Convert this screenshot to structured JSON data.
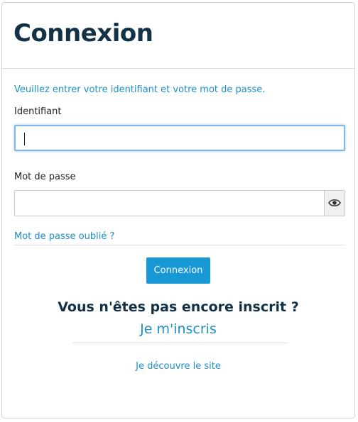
{
  "header": {
    "title": "Connexion"
  },
  "form": {
    "instructions": "Veuillez entrer votre identifiant et votre mot de passe.",
    "username": {
      "label": "Identifiant",
      "value": ""
    },
    "password": {
      "label": "Mot de passe",
      "value": "",
      "toggle_icon": "eye-icon"
    },
    "forgot_link": "Mot de passe oublié ?",
    "submit_label": "Connexion"
  },
  "signup": {
    "question": "Vous n'êtes pas encore inscrit ?",
    "link": "Je m'inscris"
  },
  "discover_link": "Je découvre le site",
  "colors": {
    "accent": "#1998d6",
    "link": "#1c8fc7",
    "title": "#133247"
  }
}
